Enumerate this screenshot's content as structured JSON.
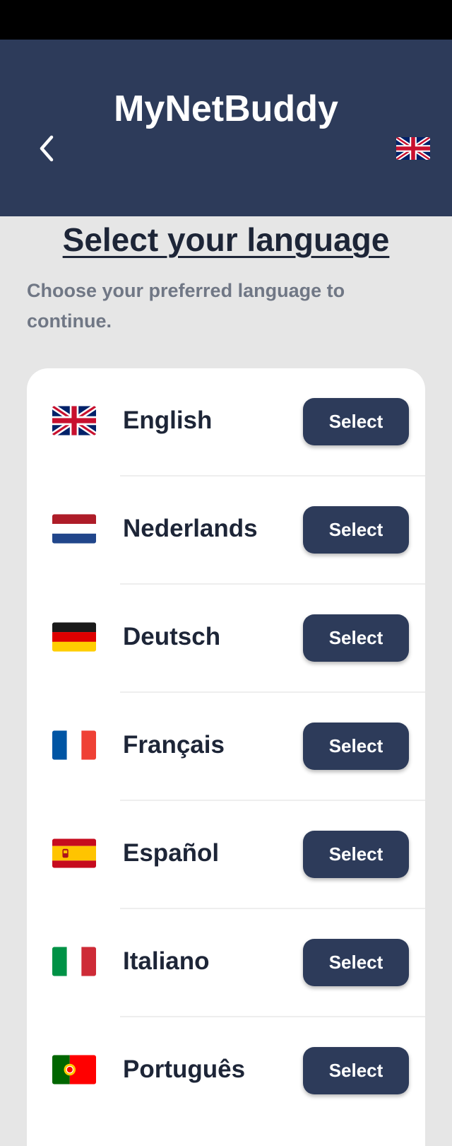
{
  "header": {
    "title": "MyNetBuddy",
    "back_icon": "chevron-left-icon",
    "current_language_flag": "uk-flag-icon",
    "background_color": "#2d3b5a"
  },
  "page": {
    "heading": "Select your language",
    "subtitle": "Choose your preferred language to continue."
  },
  "languages": [
    {
      "name": "English",
      "flag": "uk-flag-icon",
      "button": "Select"
    },
    {
      "name": "Nederlands",
      "flag": "netherlands-flag-icon",
      "button": "Select"
    },
    {
      "name": "Deutsch",
      "flag": "germany-flag-icon",
      "button": "Select"
    },
    {
      "name": "Français",
      "flag": "france-flag-icon",
      "button": "Select"
    },
    {
      "name": "Español",
      "flag": "spain-flag-icon",
      "button": "Select"
    },
    {
      "name": "Italiano",
      "flag": "italy-flag-icon",
      "button": "Select"
    },
    {
      "name": "Português",
      "flag": "portugal-flag-icon",
      "button": "Select"
    }
  ],
  "colors": {
    "accent": "#2d3b5a",
    "background": "#e6e6e6",
    "card": "#ffffff"
  }
}
